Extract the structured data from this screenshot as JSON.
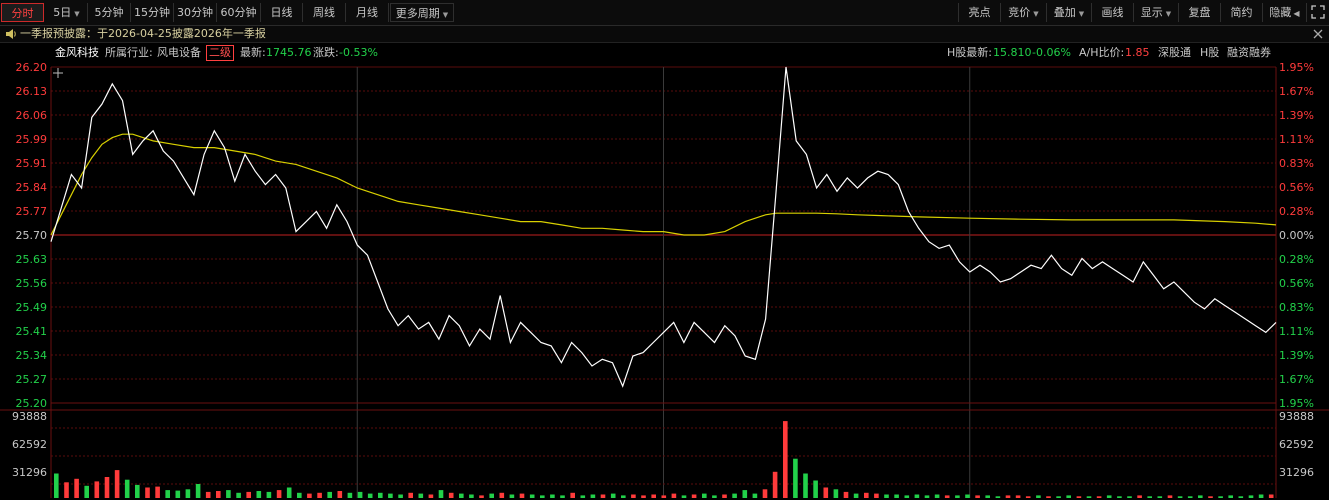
{
  "toolbar": {
    "tabs": [
      {
        "label": "分时",
        "active": true,
        "dropdown": false
      },
      {
        "label": "5日",
        "active": false,
        "dropdown": true
      },
      {
        "label": "5分钟",
        "active": false,
        "dropdown": false
      },
      {
        "label": "15分钟",
        "active": false,
        "dropdown": false
      },
      {
        "label": "30分钟",
        "active": false,
        "dropdown": false
      },
      {
        "label": "60分钟",
        "active": false,
        "dropdown": false
      },
      {
        "label": "日线",
        "active": false,
        "dropdown": false
      },
      {
        "label": "周线",
        "active": false,
        "dropdown": false
      },
      {
        "label": "月线",
        "active": false,
        "dropdown": false
      },
      {
        "label": "更多周期",
        "active": false,
        "dropdown": true
      }
    ],
    "tools": [
      {
        "label": "亮点",
        "dropdown": false
      },
      {
        "label": "竞价",
        "dropdown": true
      },
      {
        "label": "叠加",
        "dropdown": true
      },
      {
        "label": "画线",
        "dropdown": false
      },
      {
        "label": "显示",
        "dropdown": true
      },
      {
        "label": "复盘",
        "dropdown": false
      },
      {
        "label": "简约",
        "dropdown": false
      },
      {
        "label": "隐藏",
        "dropdown": false
      }
    ]
  },
  "notice": {
    "text": "一季报预披露：于2026-04-25披露2026年一季报"
  },
  "stock": {
    "name": "金风科技",
    "industry_label": "所属行业:",
    "industry": "风电设备",
    "level": "二级",
    "latest_label": "最新:",
    "latest": "1745.76",
    "change_label": "涨跌:",
    "change": "-0.53%",
    "h_latest_label": "H股最新:",
    "h_latest": "15.810",
    "h_change": "-0.06%",
    "ah_label": "A/H比价:",
    "ah_value": "1.85",
    "links": [
      "深股通",
      "H股",
      "融资融券"
    ]
  },
  "colors": {
    "up": "#ff3b3b",
    "down": "#22d14a",
    "price_line": "#ffffff",
    "avg_line": "#d8d000",
    "grid": "#5a0c0c",
    "active_tab": "#ff4040"
  },
  "chart_data": {
    "type": "line",
    "price_axis": {
      "ylim": [
        25.2,
        26.2
      ],
      "ticks": [
        "26.20",
        "26.13",
        "26.06",
        "25.99",
        "25.91",
        "25.84",
        "25.77",
        "25.70",
        "25.63",
        "25.56",
        "25.49",
        "25.41",
        "25.34",
        "25.27",
        "25.20"
      ],
      "pct_ticks": [
        "1.95%",
        "1.67%",
        "1.39%",
        "1.11%",
        "0.83%",
        "0.56%",
        "0.28%",
        "0.00%",
        "0.28%",
        "0.56%",
        "0.83%",
        "1.11%",
        "1.39%",
        "1.67%",
        "1.95%"
      ],
      "reference": 25.7
    },
    "volume_axis": {
      "ylim": [
        0,
        93888
      ],
      "ticks": [
        "93888",
        "62592",
        "31296"
      ]
    },
    "series": [
      {
        "key": "price",
        "x": [
          0,
          2,
          4,
          6,
          8,
          10,
          12,
          14,
          16,
          18,
          20,
          22,
          24,
          26,
          28,
          30,
          32,
          34,
          36,
          38,
          40,
          42,
          44,
          46,
          48,
          50,
          52,
          54,
          56,
          58,
          60,
          62,
          64,
          66,
          68,
          70,
          72,
          74,
          76,
          78,
          80,
          82,
          84,
          86,
          88,
          90,
          92,
          94,
          96,
          98,
          100,
          102,
          104,
          106,
          108,
          110,
          112,
          114,
          116,
          118,
          120,
          122,
          124,
          126,
          128,
          130,
          132,
          134,
          136,
          138,
          140,
          142,
          144,
          146,
          148,
          150,
          152,
          154,
          156,
          158,
          160,
          162,
          164,
          166,
          168,
          170,
          172,
          174,
          176,
          178,
          180,
          182,
          184,
          186,
          188,
          190,
          192,
          194,
          196,
          198,
          200,
          202,
          204,
          206,
          208,
          210,
          212,
          214,
          216,
          218,
          220,
          222,
          224,
          226,
          228,
          230,
          232,
          234,
          236,
          238,
          240
        ],
        "values": [
          25.68,
          25.78,
          25.88,
          25.84,
          26.05,
          26.09,
          26.15,
          26.1,
          25.94,
          25.98,
          26.01,
          25.95,
          25.92,
          25.87,
          25.82,
          25.94,
          26.01,
          25.96,
          25.86,
          25.94,
          25.89,
          25.85,
          25.88,
          25.84,
          25.71,
          25.74,
          25.77,
          25.72,
          25.79,
          25.74,
          25.67,
          25.64,
          25.56,
          25.48,
          25.43,
          25.46,
          25.42,
          25.44,
          25.39,
          25.46,
          25.43,
          25.37,
          25.42,
          25.39,
          25.52,
          25.38,
          25.44,
          25.41,
          25.38,
          25.37,
          25.32,
          25.38,
          25.35,
          25.31,
          25.33,
          25.32,
          25.25,
          25.34,
          25.35,
          25.38,
          25.41,
          25.44,
          25.38,
          25.44,
          25.41,
          25.38,
          25.43,
          25.4,
          25.34,
          25.33,
          25.45,
          25.82,
          26.2,
          25.98,
          25.94,
          25.84,
          25.88,
          25.83,
          25.87,
          25.84,
          25.87,
          25.89,
          25.88,
          25.85,
          25.77,
          25.72,
          25.68,
          25.66,
          25.67,
          25.62,
          25.59,
          25.61,
          25.59,
          25.56,
          25.57,
          25.59,
          25.61,
          25.6,
          25.64,
          25.6,
          25.58,
          25.63,
          25.6,
          25.62,
          25.6,
          25.58,
          25.56,
          25.62,
          25.58,
          25.54,
          25.56,
          25.53,
          25.5,
          25.48,
          25.51,
          25.49,
          25.47,
          25.45,
          25.43,
          25.41,
          25.44
        ]
      },
      {
        "key": "avg",
        "x": [
          0,
          2,
          4,
          6,
          8,
          10,
          12,
          14,
          16,
          18,
          20,
          24,
          28,
          32,
          36,
          40,
          44,
          48,
          52,
          56,
          60,
          64,
          68,
          72,
          76,
          80,
          84,
          88,
          92,
          96,
          100,
          104,
          108,
          112,
          116,
          120,
          124,
          128,
          132,
          136,
          140,
          142,
          144,
          146,
          148,
          150,
          154,
          158,
          162,
          170,
          180,
          190,
          200,
          210,
          220,
          230,
          236,
          240
        ],
        "values": [
          25.7,
          25.76,
          25.82,
          25.88,
          25.93,
          25.97,
          25.99,
          26.0,
          26.0,
          25.99,
          25.98,
          25.97,
          25.96,
          25.96,
          25.95,
          25.94,
          25.92,
          25.91,
          25.89,
          25.87,
          25.84,
          25.82,
          25.8,
          25.79,
          25.78,
          25.77,
          25.76,
          25.75,
          25.74,
          25.74,
          25.73,
          25.72,
          25.72,
          25.715,
          25.71,
          25.71,
          25.7,
          25.7,
          25.71,
          25.74,
          25.76,
          25.765,
          25.765,
          25.765,
          25.765,
          25.765,
          25.763,
          25.76,
          25.758,
          25.754,
          25.75,
          25.747,
          25.745,
          25.745,
          25.745,
          25.74,
          25.735,
          25.73
        ]
      },
      {
        "key": "volume",
        "values": [
          28000,
          18000,
          22000,
          14000,
          19000,
          24000,
          32000,
          21000,
          15000,
          12000,
          13000,
          9000,
          8500,
          10000,
          16000,
          7000,
          8000,
          9000,
          6000,
          7000,
          8000,
          7000,
          9000,
          12000,
          6000,
          5000,
          6000,
          7000,
          8000,
          6000,
          7000,
          5000,
          6000,
          5000,
          4000,
          6000,
          5000,
          4000,
          9000,
          6000,
          5000,
          4000,
          3000,
          5000,
          6000,
          4000,
          5000,
          4000,
          3000,
          4000,
          3000,
          6000,
          3000,
          4000,
          4000,
          5000,
          3000,
          4000,
          3000,
          4000,
          3000,
          5000,
          3000,
          4000,
          5000,
          3000,
          4000,
          5000,
          9000,
          5000,
          10000,
          30000,
          88000,
          45000,
          28000,
          20000,
          12000,
          10000,
          7000,
          5000,
          6000,
          5000,
          4000,
          4000,
          3000,
          4000,
          3000,
          4000,
          3000,
          3000,
          4000,
          3000,
          3000,
          2000,
          3000,
          3000,
          2000,
          3000,
          2000,
          2000,
          3000,
          2000,
          2000,
          2000,
          3000,
          2000,
          2000,
          3000,
          2000,
          2000,
          3000,
          2000,
          2000,
          3000,
          2000,
          2000,
          3000,
          2000,
          3000,
          4000,
          4000
        ]
      }
    ]
  }
}
